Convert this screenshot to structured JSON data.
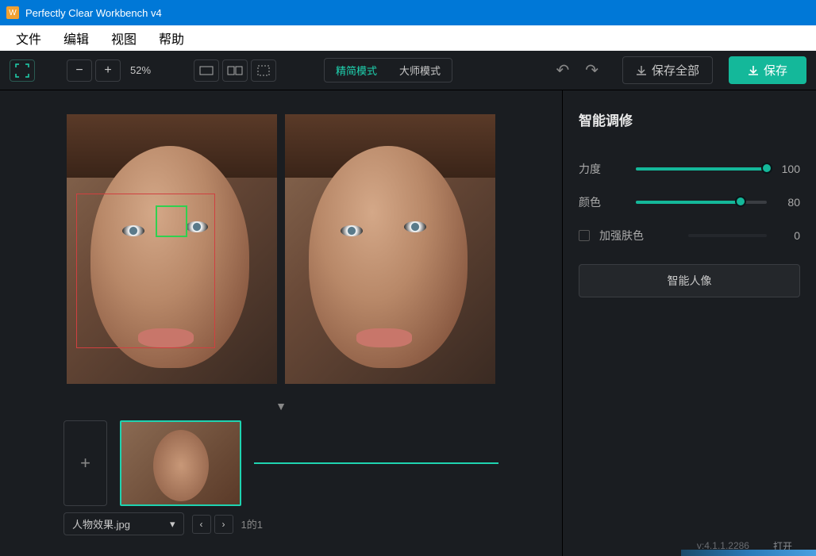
{
  "titlebar": {
    "title": "Perfectly Clear Workbench v4"
  },
  "menubar": {
    "file": "文件",
    "edit": "编辑",
    "view": "视图",
    "help": "帮助"
  },
  "toolbar": {
    "zoom": "52%",
    "mode_simple": "精简模式",
    "mode_master": "大师模式",
    "save_all": "保存全部",
    "save": "保存"
  },
  "panel": {
    "title": "智能调修",
    "intensity_label": "力度",
    "intensity_value": 100,
    "color_label": "颜色",
    "color_value": 80,
    "skin_label": "加强肤色",
    "skin_value": 0,
    "portrait_btn": "智能人像"
  },
  "file": {
    "name": "人物效果.jpg",
    "page": "1的1"
  },
  "status": {
    "version": "v:4.1.1.2286",
    "open": "打开"
  }
}
